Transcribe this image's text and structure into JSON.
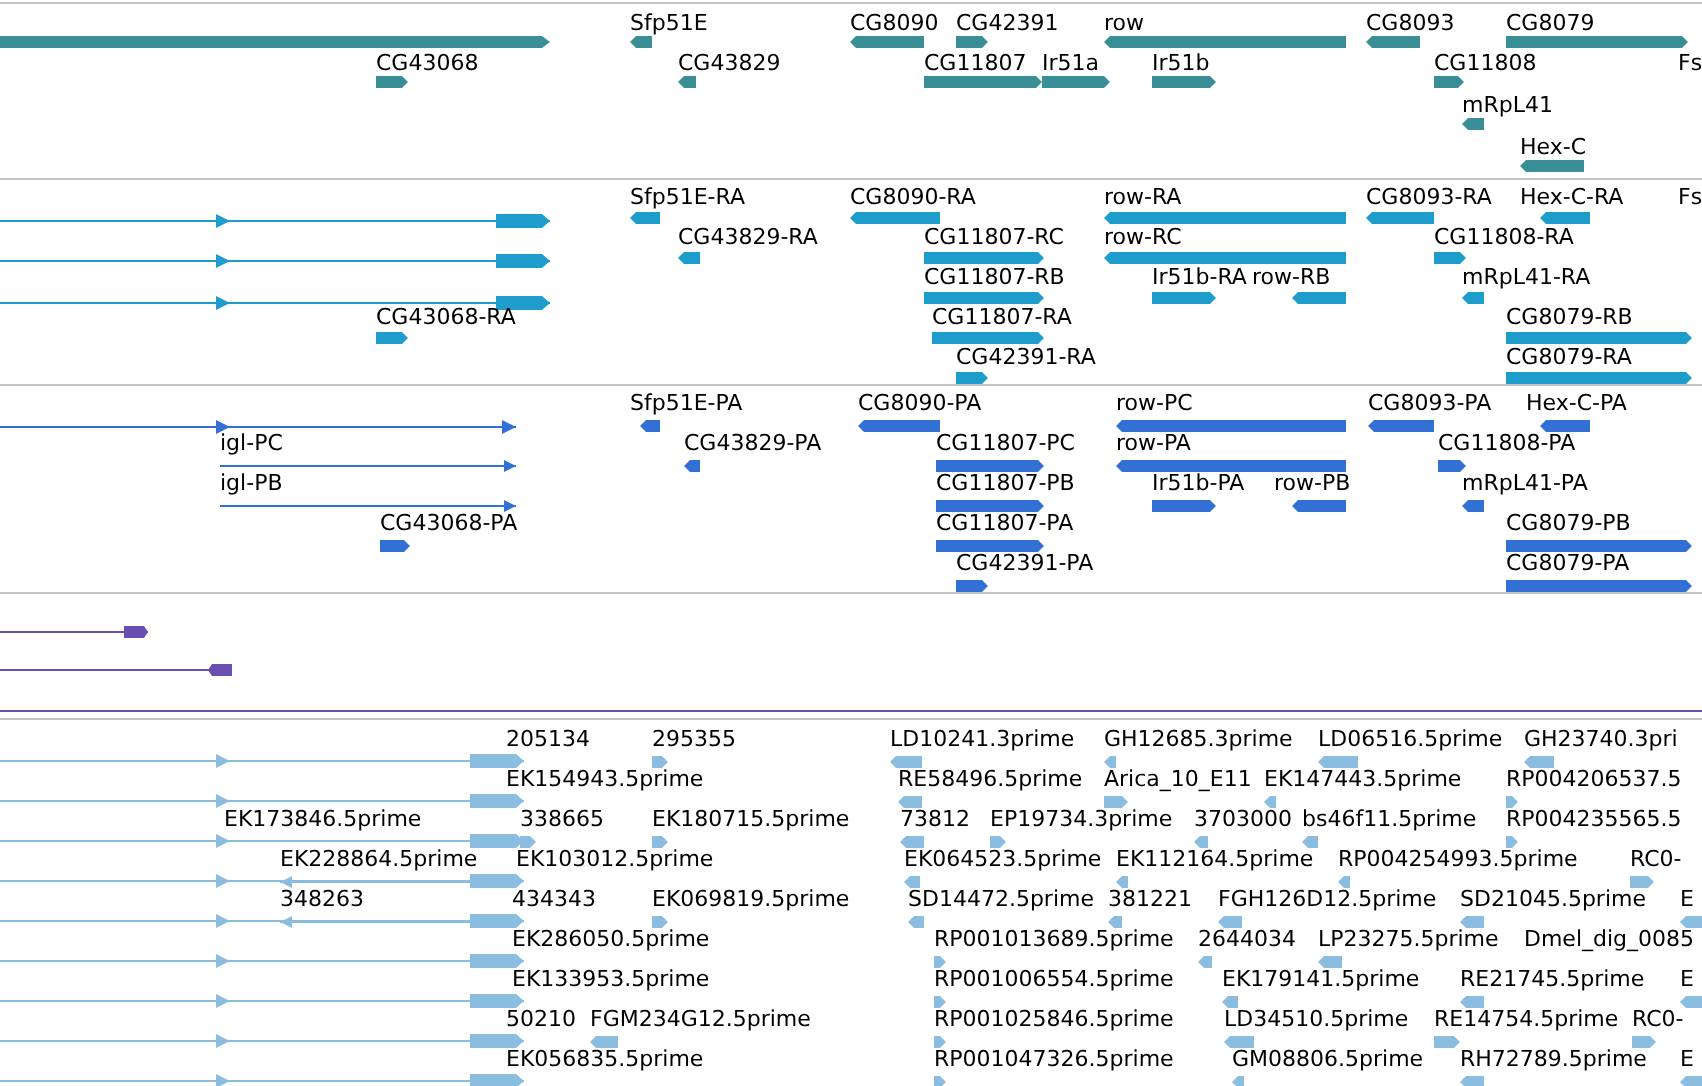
{
  "tracks": [
    {
      "kind": "gene",
      "features": [
        {
          "label": "Sfp51E",
          "reverse": true
        },
        {
          "label": "CG8090",
          "reverse": true
        },
        {
          "label": "CG42391",
          "reverse": false
        },
        {
          "label": "row",
          "reverse": true
        },
        {
          "label": "CG8093",
          "reverse": true
        },
        {
          "label": "CG8079",
          "reverse": false
        },
        {
          "label": "CG43068",
          "reverse": false
        },
        {
          "label": "CG43829",
          "reverse": true
        },
        {
          "label": "CG11807",
          "reverse": false
        },
        {
          "label": "Ir51a",
          "reverse": false
        },
        {
          "label": "Ir51b",
          "reverse": false
        },
        {
          "label": "CG11808",
          "reverse": false
        },
        {
          "label": "Fs"
        },
        {
          "label": "mRpL41",
          "reverse": true
        },
        {
          "label": "Hex-C",
          "reverse": true
        }
      ]
    },
    {
      "kind": "transcript",
      "features": [
        {
          "label": "Sfp51E-RA",
          "reverse": true
        },
        {
          "label": "CG8090-RA",
          "reverse": true
        },
        {
          "label": "row-RA",
          "reverse": true
        },
        {
          "label": "CG8093-RA",
          "reverse": true
        },
        {
          "label": "Hex-C-RA",
          "reverse": true
        },
        {
          "label": "Fs"
        },
        {
          "label": "CG43829-RA",
          "reverse": true
        },
        {
          "label": "CG11807-RC",
          "reverse": false
        },
        {
          "label": "row-RC",
          "reverse": true
        },
        {
          "label": "CG11808-RA",
          "reverse": false
        },
        {
          "label": "CG11807-RB",
          "reverse": false
        },
        {
          "label": "Ir51b-RA",
          "reverse": false
        },
        {
          "label": "row-RB",
          "reverse": true
        },
        {
          "label": "mRpL41-RA",
          "reverse": true
        },
        {
          "label": "CG43068-RA",
          "reverse": false
        },
        {
          "label": "CG11807-RA",
          "reverse": false
        },
        {
          "label": "CG8079-RB",
          "reverse": false
        },
        {
          "label": "CG42391-RA",
          "reverse": false
        },
        {
          "label": "CG8079-RA",
          "reverse": false
        }
      ]
    },
    {
      "kind": "protein",
      "features": [
        {
          "label": "Sfp51E-PA",
          "reverse": true
        },
        {
          "label": "CG8090-PA",
          "reverse": true
        },
        {
          "label": "row-PC",
          "reverse": true
        },
        {
          "label": "CG8093-PA",
          "reverse": true
        },
        {
          "label": "Hex-C-PA",
          "reverse": true
        },
        {
          "label": "igl-PC",
          "reverse": false
        },
        {
          "label": "CG43829-PA",
          "reverse": true
        },
        {
          "label": "CG11807-PC",
          "reverse": false
        },
        {
          "label": "row-PA",
          "reverse": true
        },
        {
          "label": "CG11808-PA",
          "reverse": false
        },
        {
          "label": "igl-PB",
          "reverse": false
        },
        {
          "label": "CG11807-PB",
          "reverse": false
        },
        {
          "label": "Ir51b-PA",
          "reverse": false
        },
        {
          "label": "row-PB",
          "reverse": true
        },
        {
          "label": "mRpL41-PA",
          "reverse": true
        },
        {
          "label": "CG43068-PA",
          "reverse": false
        },
        {
          "label": "CG11807-PA",
          "reverse": false
        },
        {
          "label": "CG8079-PB",
          "reverse": false
        },
        {
          "label": "CG42391-PA",
          "reverse": false
        },
        {
          "label": "CG8079-PA",
          "reverse": false
        }
      ]
    },
    {
      "kind": "est",
      "features": [
        {
          "label": "205134"
        },
        {
          "label": "295355",
          "reverse": false
        },
        {
          "label": "LD10241.3prime",
          "reverse": true
        },
        {
          "label": "GH12685.3prime",
          "reverse": true
        },
        {
          "label": "LD06516.5prime",
          "reverse": true
        },
        {
          "label": "GH23740.3pri",
          "reverse": true
        },
        {
          "label": "EK154943.5prime"
        },
        {
          "label": "RE58496.5prime",
          "reverse": true
        },
        {
          "label": "Arica_10_E11",
          "reverse": false
        },
        {
          "label": "EK147443.5prime",
          "reverse": true
        },
        {
          "label": "RP004206537.5",
          "reverse": false
        },
        {
          "label": "EK173846.5prime"
        },
        {
          "label": "338665",
          "reverse": false
        },
        {
          "label": "EK180715.5prime",
          "reverse": false
        },
        {
          "label": "73812",
          "reverse": true
        },
        {
          "label": "EP19734.3prime",
          "reverse": false
        },
        {
          "label": "3703000",
          "reverse": true
        },
        {
          "label": "bs46f11.5prime",
          "reverse": true
        },
        {
          "label": "RP004235565.5",
          "reverse": false
        },
        {
          "label": "EK228864.5prime",
          "reverse": true
        },
        {
          "label": "EK103012.5prime"
        },
        {
          "label": "EK064523.5prime",
          "reverse": true
        },
        {
          "label": "EK112164.5prime",
          "reverse": true
        },
        {
          "label": "RP004254993.5prime",
          "reverse": true
        },
        {
          "label": "RC0-",
          "reverse": false
        },
        {
          "label": "348263",
          "reverse": true
        },
        {
          "label": "434343"
        },
        {
          "label": "EK069819.5prime",
          "reverse": false
        },
        {
          "label": "SD14472.5prime",
          "reverse": true
        },
        {
          "label": "381221",
          "reverse": true
        },
        {
          "label": "FGH126D12.5prime",
          "reverse": true
        },
        {
          "label": "SD21045.5prime",
          "reverse": true
        },
        {
          "label": "E",
          "reverse": true
        },
        {
          "label": "EK286050.5prime"
        },
        {
          "label": "RP001013689.5prime",
          "reverse": false
        },
        {
          "label": "2644034",
          "reverse": true
        },
        {
          "label": "LP23275.5prime",
          "reverse": true
        },
        {
          "label": "Dmel_dig_0085"
        },
        {
          "label": "EK133953.5prime"
        },
        {
          "label": "RP001006554.5prime",
          "reverse": false
        },
        {
          "label": "EK179141.5prime",
          "reverse": true
        },
        {
          "label": "RE21745.5prime",
          "reverse": true
        },
        {
          "label": "E",
          "reverse": true
        },
        {
          "label": "50210"
        },
        {
          "label": "FGM234G12.5prime",
          "reverse": true
        },
        {
          "label": "RP001025846.5prime",
          "reverse": false
        },
        {
          "label": "LD34510.5prime",
          "reverse": true
        },
        {
          "label": "RE14754.5prime",
          "reverse": false
        },
        {
          "label": "RC0-",
          "reverse": false
        },
        {
          "label": "EK056835.5prime"
        },
        {
          "label": "RP001047326.5prime",
          "reverse": false
        },
        {
          "label": "GM08806.5prime",
          "reverse": true
        },
        {
          "label": "RH72789.5prime",
          "reverse": true
        },
        {
          "label": "E",
          "reverse": true
        }
      ]
    }
  ]
}
